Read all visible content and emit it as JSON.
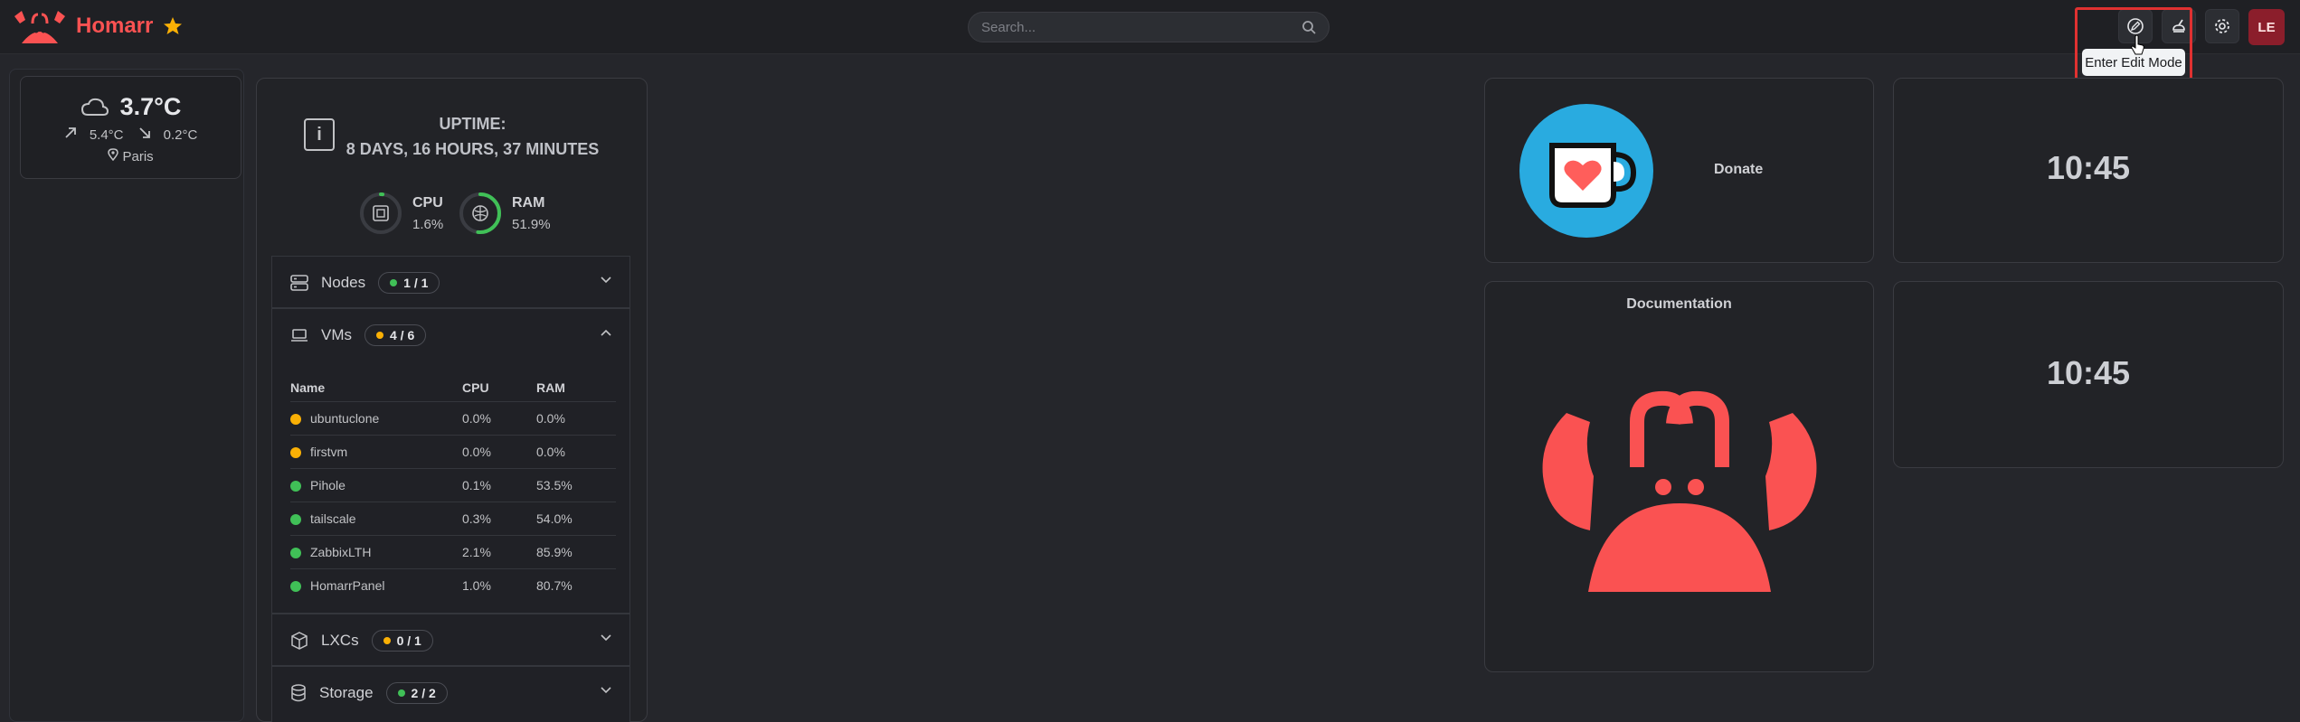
{
  "app": {
    "name": "Homarr"
  },
  "search": {
    "placeholder": "Search..."
  },
  "header": {
    "avatar_initials": "LE",
    "tooltip": "Enter Edit Mode"
  },
  "weather": {
    "temperature": "3.7°C",
    "max": "5.4°C",
    "min": "0.2°C",
    "location": "Paris"
  },
  "system": {
    "uptime_label": "UPTIME:",
    "uptime_value": "8 DAYS, 16 HOURS, 37 MINUTES",
    "cpu": {
      "label": "CPU",
      "value": "1.6%",
      "fraction": 0.016
    },
    "ram": {
      "label": "RAM",
      "value": "51.9%",
      "fraction": 0.519
    },
    "sections": {
      "nodes": {
        "label": "Nodes",
        "count": "1 / 1"
      },
      "vms": {
        "label": "VMs",
        "count": "4 / 6"
      },
      "lxcs": {
        "label": "LXCs",
        "count": "0 / 1"
      },
      "storage": {
        "label": "Storage",
        "count": "2 / 2"
      }
    },
    "vm_table": {
      "headers": [
        "Name",
        "CPU",
        "RAM"
      ],
      "rows": [
        {
          "name": "ubuntuclone",
          "cpu": "0.0%",
          "ram": "0.0%",
          "status": "stopped"
        },
        {
          "name": "firstvm",
          "cpu": "0.0%",
          "ram": "0.0%",
          "status": "stopped"
        },
        {
          "name": "Pihole",
          "cpu": "0.1%",
          "ram": "53.5%",
          "status": "running"
        },
        {
          "name": "tailscale",
          "cpu": "0.3%",
          "ram": "54.0%",
          "status": "running"
        },
        {
          "name": "ZabbixLTH",
          "cpu": "2.1%",
          "ram": "85.9%",
          "status": "running"
        },
        {
          "name": "HomarrPanel",
          "cpu": "1.0%",
          "ram": "80.7%",
          "status": "running"
        }
      ]
    }
  },
  "apps": {
    "donate": {
      "label": "Donate"
    },
    "documentation": {
      "label": "Documentation"
    }
  },
  "clocks": {
    "time1": "10:45",
    "time2": "10:45"
  },
  "colors": {
    "brand": "#fa5252",
    "running": "#40c057",
    "stopped": "#fab005",
    "kofi": "#29abe0"
  }
}
